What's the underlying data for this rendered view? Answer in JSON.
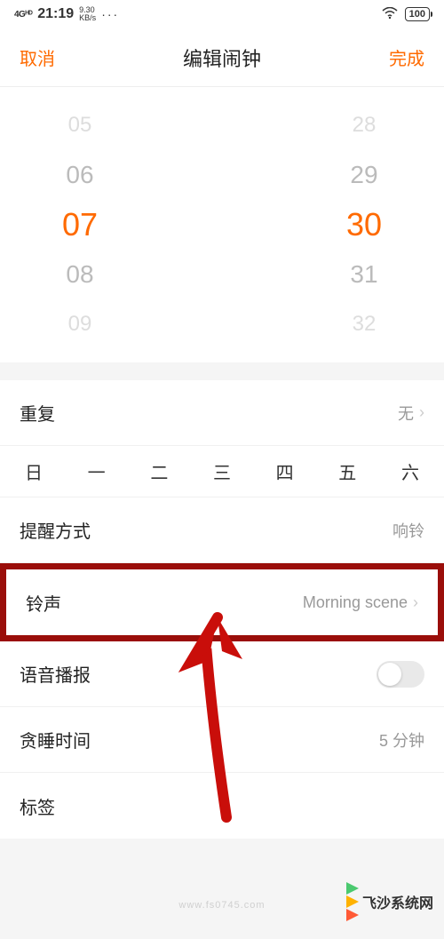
{
  "status_bar": {
    "signal_label": "4Gᴴᴰ",
    "time": "21:19",
    "data_rate": "9.30",
    "data_unit": "KB/s",
    "dots": "···",
    "battery": "100"
  },
  "nav": {
    "cancel": "取消",
    "title": "编辑闹钟",
    "done": "完成"
  },
  "picker": {
    "rows": [
      {
        "hour": "05",
        "minute": "28"
      },
      {
        "hour": "06",
        "minute": "29"
      },
      {
        "hour": "07",
        "minute": "30"
      },
      {
        "hour": "08",
        "minute": "31"
      },
      {
        "hour": "09",
        "minute": "32"
      }
    ]
  },
  "repeat": {
    "label": "重复",
    "value": "无",
    "days": [
      "日",
      "一",
      "二",
      "三",
      "四",
      "五",
      "六"
    ]
  },
  "reminder": {
    "label": "提醒方式",
    "value": "响铃"
  },
  "ringtone": {
    "label": "铃声",
    "value": "Morning scene"
  },
  "voice": {
    "label": "语音播报"
  },
  "snooze": {
    "label": "贪睡时间",
    "value": "5 分钟"
  },
  "tag": {
    "label": "标签"
  },
  "watermark": {
    "url": "www.fs0745.com",
    "site": "飞沙系统网"
  }
}
